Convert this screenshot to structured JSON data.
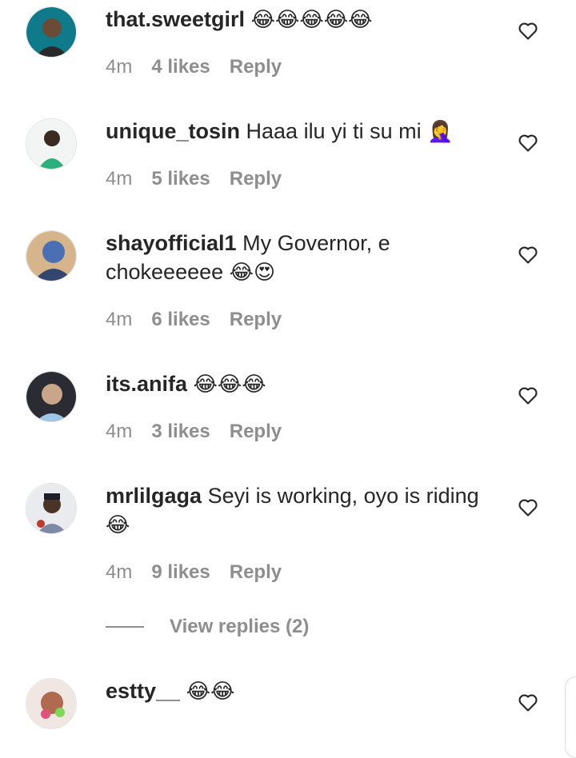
{
  "comments": [
    {
      "username": "that.sweetgirl",
      "text": "",
      "emoji": "😂😂😂😂😂",
      "time": "4m",
      "likes": "4 likes",
      "reply": "Reply",
      "avatar_color": "#0f7a8a"
    },
    {
      "username": "unique_tosin",
      "text": "Haaa ilu yi ti su mi",
      "emoji": "🤦‍♀️",
      "time": "4m",
      "likes": "5 likes",
      "reply": "Reply",
      "avatar_color": "#2bb07d"
    },
    {
      "username": "shayofficial1",
      "text": "My Governor, e chokeeeeee",
      "emoji": "😂😍",
      "time": "4m",
      "likes": "6 likes",
      "reply": "Reply",
      "avatar_color": "#4a6fb3"
    },
    {
      "username": "its.anifa",
      "text": "",
      "emoji": "😂😂😂",
      "time": "4m",
      "likes": "3 likes",
      "reply": "Reply",
      "avatar_color": "#2b2b33"
    },
    {
      "username": "mrlilgaga",
      "text": "Seyi is working, oyo is riding",
      "emoji": "😂",
      "time": "4m",
      "likes": "9 likes",
      "reply": "Reply",
      "avatar_color": "#7d8aa6"
    },
    {
      "username": "estty__",
      "text": "",
      "emoji": "😂😂",
      "avatar_color": "#e0527a"
    }
  ],
  "view_replies": "View replies (2)",
  "colors": {
    "text": "#262626",
    "muted": "#8e8e8e",
    "background": "#ffffff"
  },
  "icons": {
    "like": "heart-outline-icon"
  }
}
